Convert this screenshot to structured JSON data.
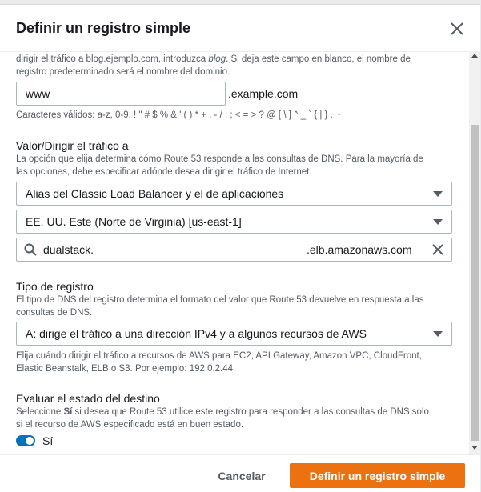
{
  "modal": {
    "title": "Definir un registro simple"
  },
  "record_name": {
    "help_partial_1": "dirigir el tráfico a blog.ejemplo.com, introduzca ",
    "help_partial_italic": "blog",
    "help_partial_2": ". Si deja este campo en blanco, el nombre de",
    "help_line2": "registro predeterminado será el nombre del dominio.",
    "value": "www",
    "suffix": ".example.com",
    "valid_chars": "Caracteres válidos: a-z, 0-9, ! \" # $ % & ' ( ) * + , - / : ; < = > ? @ [ \\ ] ^ _ ` { | } . ~"
  },
  "value_target": {
    "label": "Valor/Dirigir el tráfico a",
    "desc_line1": "La opción que elija determina cómo Route 53 responde a las consultas de DNS. Para la mayoría de",
    "desc_line2": "las opciones, debe especificar adónde desea dirigir el tráfico de Internet.",
    "endpoint_select": "Alias del Classic Load Balancer y el de aplicaciones",
    "region_select": "EE. UU. Este (Norte de Virginia) [us-east-1]",
    "search_prefix": "dualstack.",
    "search_suffix": ".elb.amazonaws.com"
  },
  "record_type": {
    "label": "Tipo de registro",
    "desc_line1": "El tipo de DNS del registro determina el formato del valor que Route 53 devuelve en respuesta a las",
    "desc_line2": "consultas de DNS.",
    "select": "A: dirige el tráfico a una dirección IPv4 y a algunos recursos de AWS",
    "hint_line1": "Elija cuándo dirigir el tráfico a recursos de AWS para EC2, API Gateway, Amazon VPC, CloudFront,",
    "hint_line2": "Elastic Beanstalk, ELB o S3. Por ejemplo: 192.0.2.44."
  },
  "health": {
    "label": "Evaluar el estado del destino",
    "desc_line1_a": "Seleccione ",
    "desc_line1_bold": "Sí",
    "desc_line1_b": " si desea que Route 53 utilice este registro para responder a las consultas de DNS solo",
    "desc_line2": "si el recurso de AWS especificado está en buen estado.",
    "toggle_label": "Sí",
    "toggle_on": true
  },
  "footer": {
    "cancel": "Cancelar",
    "submit": "Definir un registro simple"
  },
  "colors": {
    "primary": "#ec7211",
    "toggle": "#0073bb"
  },
  "icons": [
    "close-icon",
    "search-icon",
    "clear-icon",
    "caret-down-icon"
  ]
}
